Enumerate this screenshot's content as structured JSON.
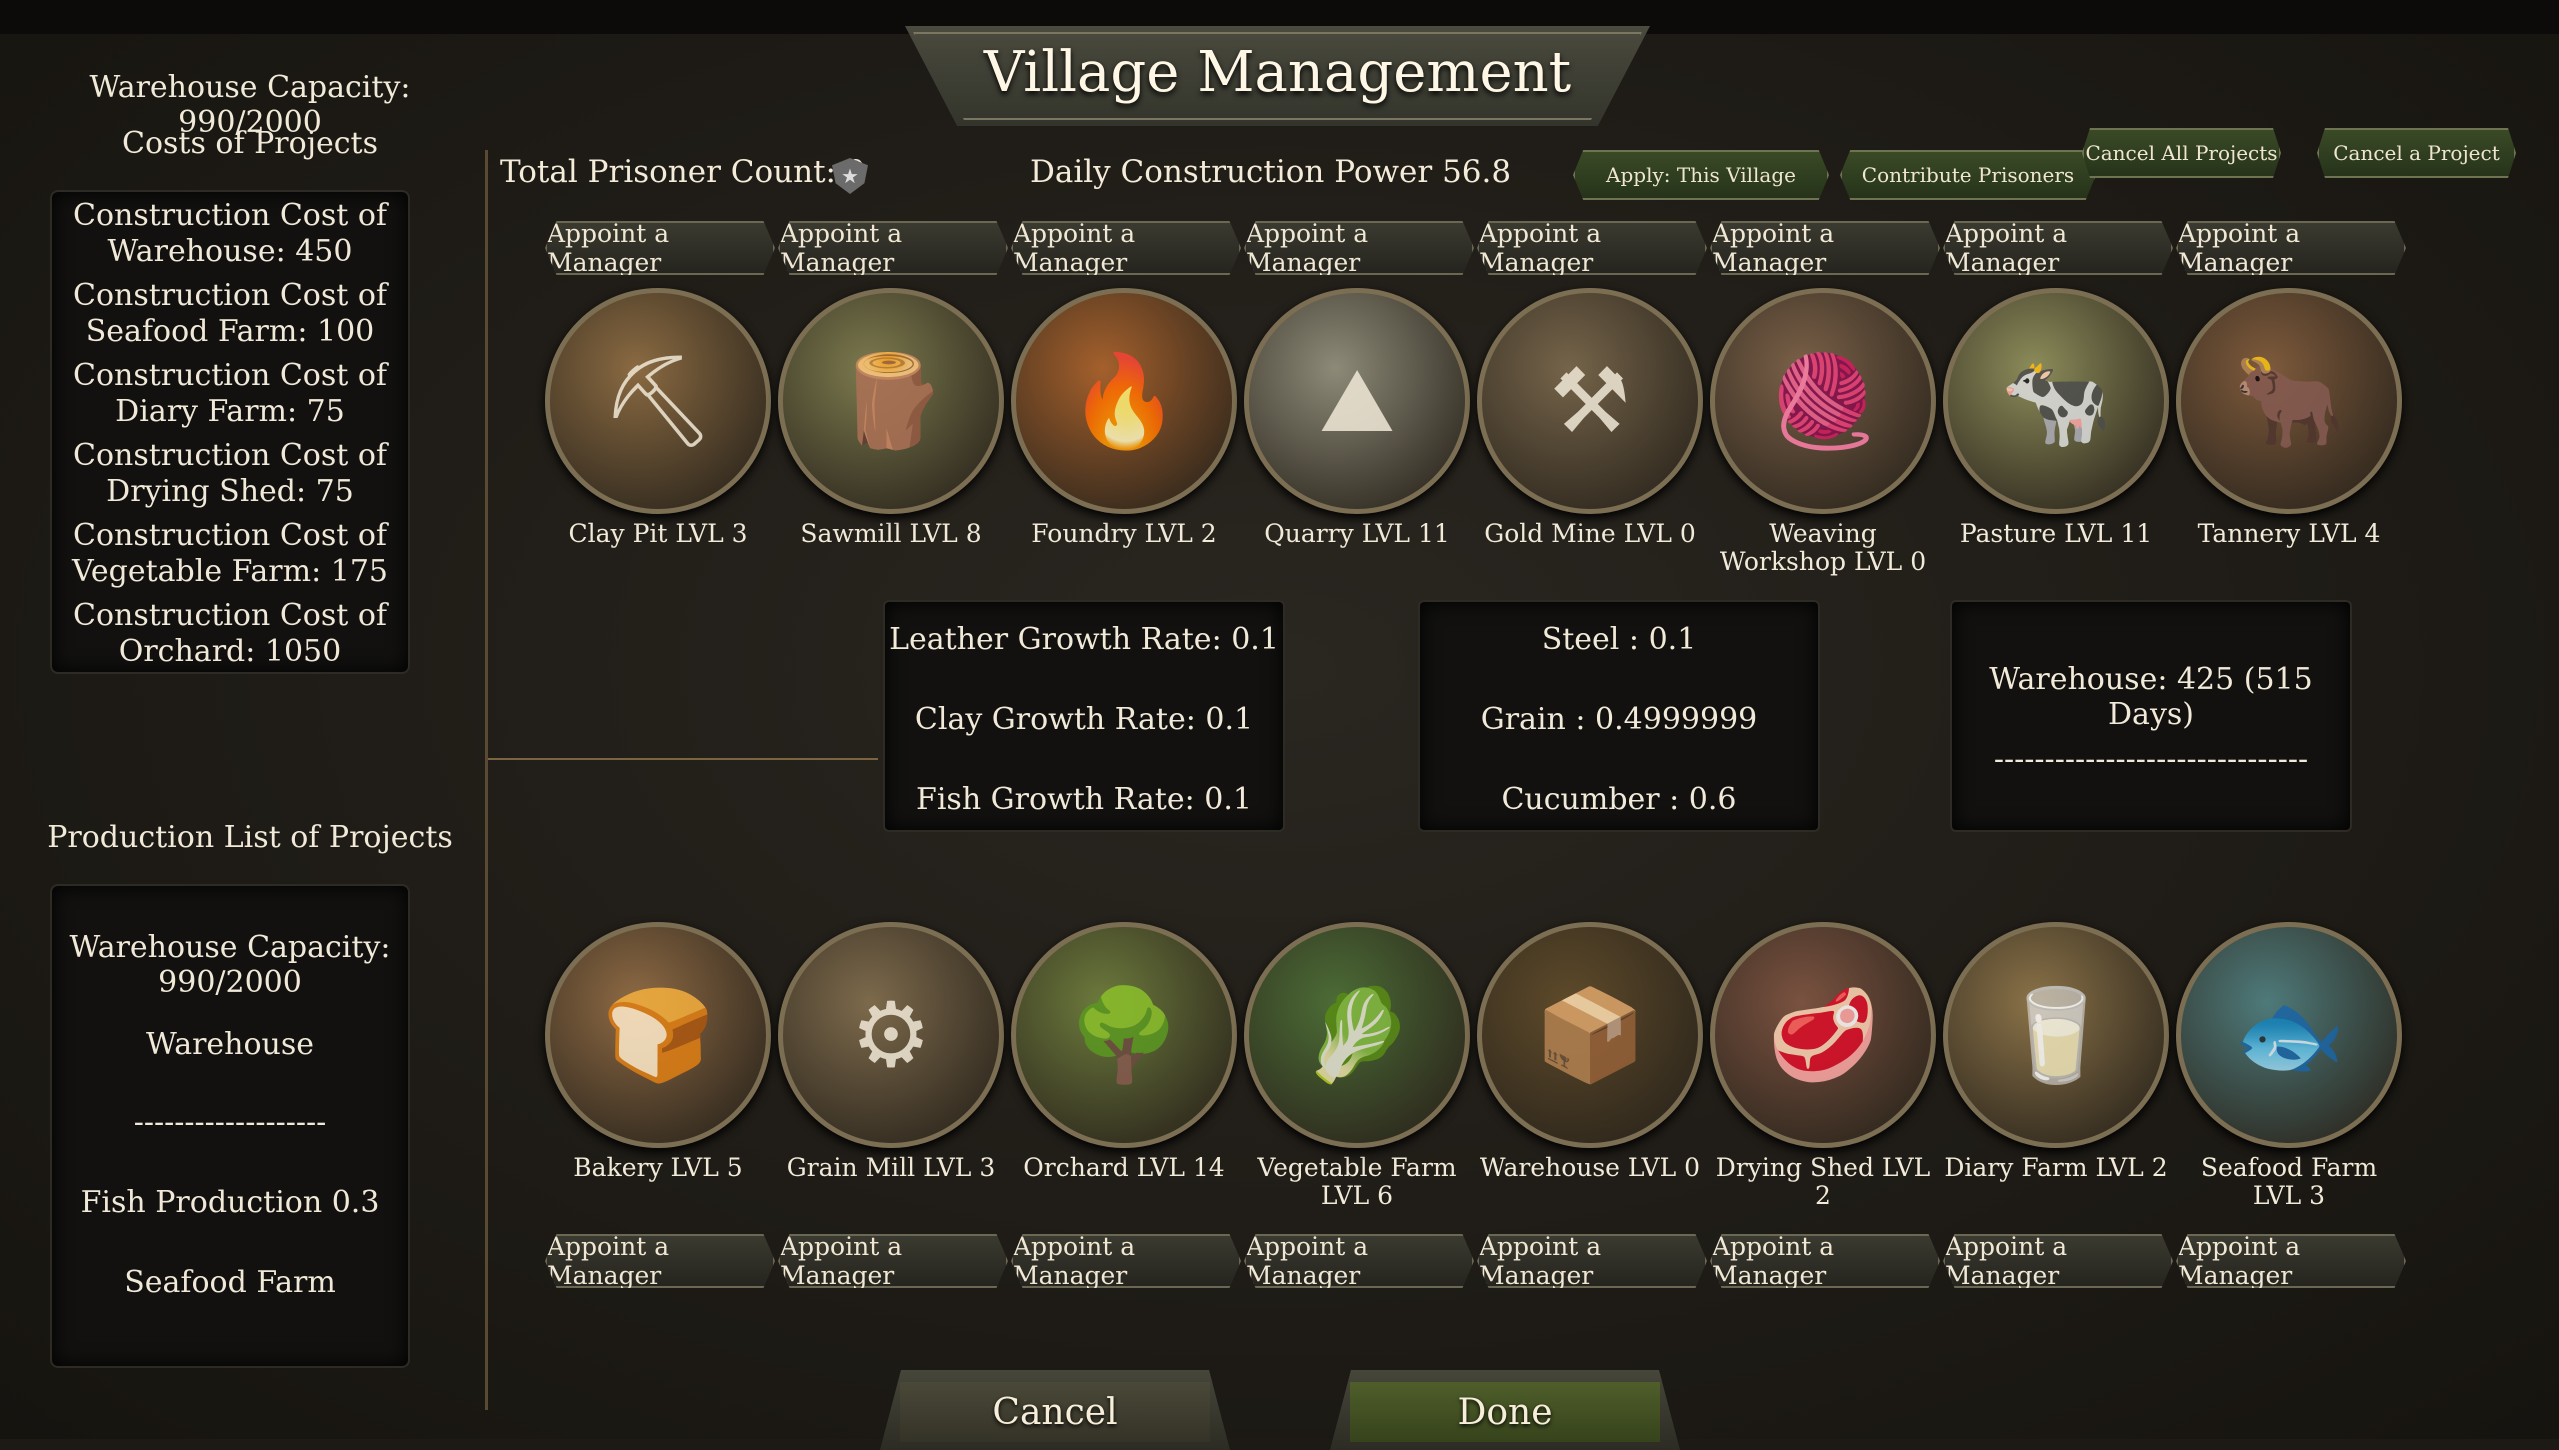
{
  "title": "Village Management",
  "left": {
    "warehouse_capacity": "Warehouse Capacity: 990/2000",
    "costs_heading": "Costs of Projects",
    "costs": [
      [
        "Construction Cost of",
        "Warehouse: 450"
      ],
      [
        "Construction Cost of",
        "Seafood Farm: 100"
      ],
      [
        "Construction Cost of",
        "Diary Farm: 75"
      ],
      [
        "Construction Cost of",
        "Drying Shed: 75"
      ],
      [
        "Construction Cost of",
        "Vegetable Farm: 175"
      ],
      [
        "Construction Cost of",
        "Orchard: 1050"
      ]
    ],
    "production_heading": "Production List of Projects",
    "production": {
      "capacity_line1": "Warehouse Capacity:",
      "capacity_line2": "990/2000",
      "warehouse": "Warehouse",
      "separator": "-------------------",
      "fish": "Fish Production 0.3",
      "seafood": "Seafood Farm"
    }
  },
  "header": {
    "prisoner_count": "Total Prisoner Count: 0",
    "construction_power": "Daily Construction Power 56.8",
    "apply_village": "Apply: This Village",
    "contribute_prisoners": "Contribute Prisoners",
    "cancel_all": "Cancel All Projects",
    "cancel_project": "Cancel a Project"
  },
  "appoint_label": "Appoint a Manager",
  "buildings_top": [
    {
      "name": "Clay Pit LVL 3",
      "icon": "clay-pit-icon",
      "glyph": "⛏",
      "color": "#8a6a42"
    },
    {
      "name": "Sawmill LVL 8",
      "icon": "sawmill-icon",
      "glyph": "🪵",
      "color": "#7c7a4e"
    },
    {
      "name": "Foundry LVL 2",
      "icon": "foundry-icon",
      "glyph": "🔥",
      "color": "#a4602c"
    },
    {
      "name": "Quarry LVL 11",
      "icon": "quarry-icon",
      "glyph": "⛰",
      "color": "#8d8a78"
    },
    {
      "name": "Gold Mine LVL 0",
      "icon": "gold-mine-icon",
      "glyph": "⚒",
      "color": "#75644a"
    },
    {
      "name": "Weaving Workshop LVL 0",
      "icon": "weaving-icon",
      "glyph": "🧶",
      "color": "#7a6048"
    },
    {
      "name": "Pasture LVL 11",
      "icon": "pasture-icon",
      "glyph": "🐄",
      "color": "#8c8c5a"
    },
    {
      "name": "Tannery LVL 4",
      "icon": "tannery-icon",
      "glyph": "🐂",
      "color": "#7e5a3c"
    }
  ],
  "buildings_bottom": [
    {
      "name": "Bakery LVL 5",
      "icon": "bakery-icon",
      "glyph": "🍞",
      "color": "#8e6a44"
    },
    {
      "name": "Grain Mill LVL 3",
      "icon": "grain-mill-icon",
      "glyph": "⚙",
      "color": "#7d6a4c"
    },
    {
      "name": "Orchard LVL 14",
      "icon": "orchard-icon",
      "glyph": "🌳",
      "color": "#6c7a3c"
    },
    {
      "name": "Vegetable Farm LVL 6",
      "icon": "vegetable-farm-icon",
      "glyph": "🥬",
      "color": "#4c6c36"
    },
    {
      "name": "Warehouse LVL 0",
      "icon": "warehouse-icon",
      "glyph": "📦",
      "color": "#5e4a2a"
    },
    {
      "name": "Drying Shed LVL 2",
      "icon": "drying-shed-icon",
      "glyph": "🥩",
      "color": "#7a5240"
    },
    {
      "name": "Diary Farm LVL 2",
      "icon": "diary-farm-icon",
      "glyph": "🥛",
      "color": "#8a7248"
    },
    {
      "name": "Seafood Farm LVL 3",
      "icon": "seafood-farm-icon",
      "glyph": "🐟",
      "color": "#4e7a7a"
    }
  ],
  "stats": {
    "box1": [
      "Leather Growth Rate: 0.1",
      "Clay Growth Rate: 0.1",
      "Fish Growth Rate: 0.1"
    ],
    "box2": [
      "Steel : 0.1",
      "Grain : 0.4999999",
      "Cucumber : 0.6"
    ],
    "box3": [
      "Warehouse: 425 (515 Days)",
      "-------------------------------"
    ]
  },
  "buttons": {
    "cancel": "Cancel",
    "done": "Done"
  }
}
